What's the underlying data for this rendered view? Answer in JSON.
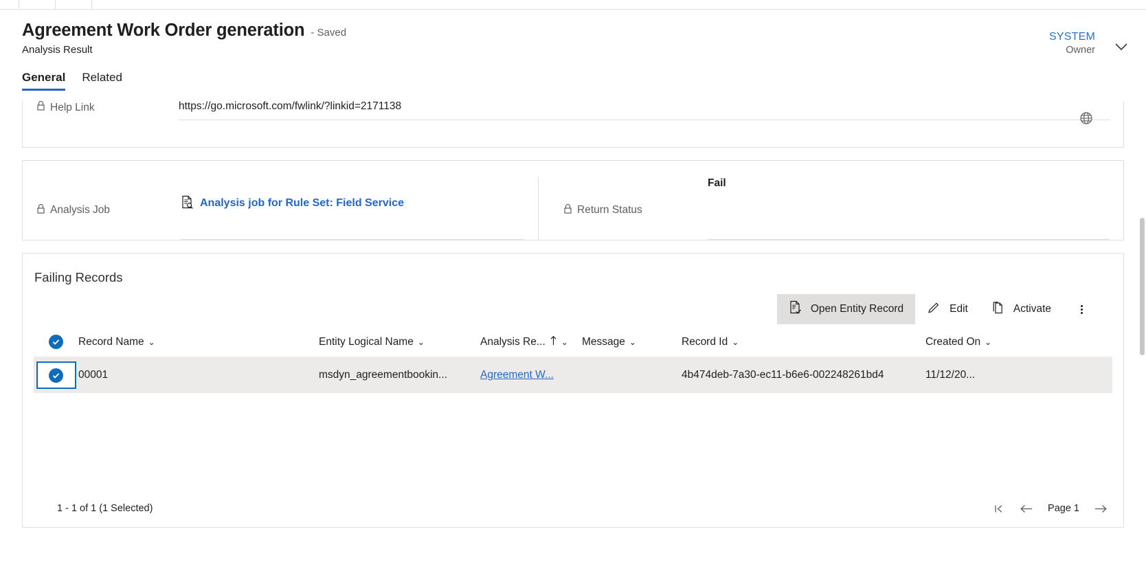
{
  "header": {
    "title": "Agreement Work Order generation",
    "saved_state": "- Saved",
    "subtitle": "Analysis Result",
    "tabs": [
      {
        "label": "General",
        "active": true
      },
      {
        "label": "Related",
        "active": false
      }
    ],
    "owner": {
      "name": "SYSTEM",
      "role": "Owner",
      "chevron_icon": "chevron-down-icon"
    }
  },
  "help_section": {
    "label": "Help Link",
    "label_icon": "lock-icon",
    "value": "https://go.microsoft.com/fwlink/?linkid=2171138",
    "trailing_icon": "globe-icon"
  },
  "details_section": {
    "analysis_job": {
      "label": "Analysis Job",
      "label_icon": "lock-icon",
      "value_icon": "document-search-icon",
      "value": "Analysis job for Rule Set: Field Service"
    },
    "return_status": {
      "label": "Return Status",
      "label_icon": "lock-icon",
      "value": "Fail"
    }
  },
  "failing_records": {
    "title": "Failing Records",
    "commands": [
      {
        "label": "Open Entity Record",
        "icon": "open-entity-record-icon",
        "selected": true
      },
      {
        "label": "Edit",
        "icon": "pencil-icon",
        "selected": false
      },
      {
        "label": "Activate",
        "icon": "copy-icon",
        "selected": false
      }
    ],
    "overflow_icon": "more-vertical-icon",
    "columns": [
      {
        "label": "Record Name",
        "sorted": false
      },
      {
        "label": "Entity Logical Name",
        "sorted": false
      },
      {
        "label": "Analysis Re...",
        "sorted": true,
        "sort_dir": "ascending"
      },
      {
        "label": "Message",
        "sorted": false
      },
      {
        "label": "Record Id",
        "sorted": false
      },
      {
        "label": "Created On",
        "sorted": false
      }
    ],
    "select_all_icon": "checkbox-checked-icon",
    "rows": [
      {
        "selected": true,
        "record_name": "00001",
        "entity_logical_name": "msdyn_agreementbookin...",
        "analysis_result": "Agreement W...",
        "message": "",
        "record_id": "4b474deb-7a30-ec11-b6e6-002248261bd4",
        "created_on": "11/12/20..."
      }
    ],
    "footer": {
      "count_text": "1 - 1 of 1 (1 Selected)",
      "first_page_icon": "first-page-icon",
      "previous_page_icon": "previous-page-icon",
      "page_label": "Page 1",
      "next_page_icon": "next-page-icon"
    }
  },
  "colors": {
    "accent_blue": "#2266cc",
    "checkbox_blue": "#0f6cbd",
    "selected_row": "#edebe9",
    "command_selected": "#e1dfdd"
  }
}
